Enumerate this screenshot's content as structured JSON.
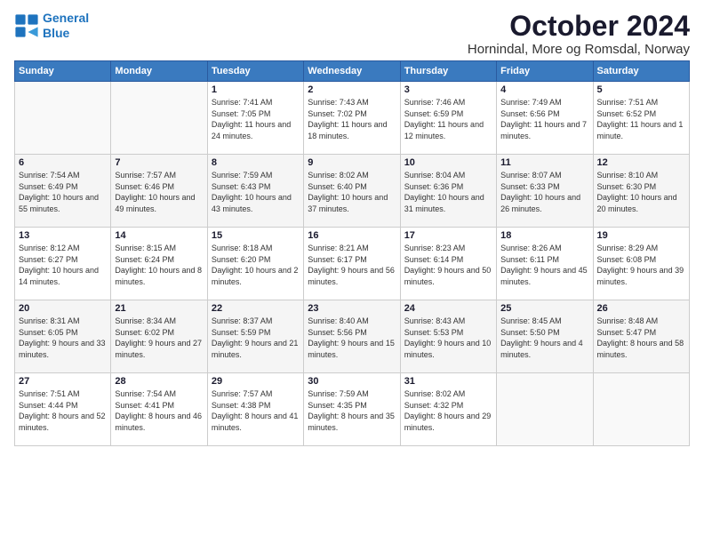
{
  "logo": {
    "line1": "General",
    "line2": "Blue"
  },
  "title": "October 2024",
  "location": "Hornindal, More og Romsdal, Norway",
  "days_of_week": [
    "Sunday",
    "Monday",
    "Tuesday",
    "Wednesday",
    "Thursday",
    "Friday",
    "Saturday"
  ],
  "weeks": [
    [
      {
        "day": "",
        "info": ""
      },
      {
        "day": "",
        "info": ""
      },
      {
        "day": "1",
        "info": "Sunrise: 7:41 AM\nSunset: 7:05 PM\nDaylight: 11 hours\nand 24 minutes."
      },
      {
        "day": "2",
        "info": "Sunrise: 7:43 AM\nSunset: 7:02 PM\nDaylight: 11 hours\nand 18 minutes."
      },
      {
        "day": "3",
        "info": "Sunrise: 7:46 AM\nSunset: 6:59 PM\nDaylight: 11 hours\nand 12 minutes."
      },
      {
        "day": "4",
        "info": "Sunrise: 7:49 AM\nSunset: 6:56 PM\nDaylight: 11 hours\nand 7 minutes."
      },
      {
        "day": "5",
        "info": "Sunrise: 7:51 AM\nSunset: 6:52 PM\nDaylight: 11 hours\nand 1 minute."
      }
    ],
    [
      {
        "day": "6",
        "info": "Sunrise: 7:54 AM\nSunset: 6:49 PM\nDaylight: 10 hours\nand 55 minutes."
      },
      {
        "day": "7",
        "info": "Sunrise: 7:57 AM\nSunset: 6:46 PM\nDaylight: 10 hours\nand 49 minutes."
      },
      {
        "day": "8",
        "info": "Sunrise: 7:59 AM\nSunset: 6:43 PM\nDaylight: 10 hours\nand 43 minutes."
      },
      {
        "day": "9",
        "info": "Sunrise: 8:02 AM\nSunset: 6:40 PM\nDaylight: 10 hours\nand 37 minutes."
      },
      {
        "day": "10",
        "info": "Sunrise: 8:04 AM\nSunset: 6:36 PM\nDaylight: 10 hours\nand 31 minutes."
      },
      {
        "day": "11",
        "info": "Sunrise: 8:07 AM\nSunset: 6:33 PM\nDaylight: 10 hours\nand 26 minutes."
      },
      {
        "day": "12",
        "info": "Sunrise: 8:10 AM\nSunset: 6:30 PM\nDaylight: 10 hours\nand 20 minutes."
      }
    ],
    [
      {
        "day": "13",
        "info": "Sunrise: 8:12 AM\nSunset: 6:27 PM\nDaylight: 10 hours\nand 14 minutes."
      },
      {
        "day": "14",
        "info": "Sunrise: 8:15 AM\nSunset: 6:24 PM\nDaylight: 10 hours\nand 8 minutes."
      },
      {
        "day": "15",
        "info": "Sunrise: 8:18 AM\nSunset: 6:20 PM\nDaylight: 10 hours\nand 2 minutes."
      },
      {
        "day": "16",
        "info": "Sunrise: 8:21 AM\nSunset: 6:17 PM\nDaylight: 9 hours\nand 56 minutes."
      },
      {
        "day": "17",
        "info": "Sunrise: 8:23 AM\nSunset: 6:14 PM\nDaylight: 9 hours\nand 50 minutes."
      },
      {
        "day": "18",
        "info": "Sunrise: 8:26 AM\nSunset: 6:11 PM\nDaylight: 9 hours\nand 45 minutes."
      },
      {
        "day": "19",
        "info": "Sunrise: 8:29 AM\nSunset: 6:08 PM\nDaylight: 9 hours\nand 39 minutes."
      }
    ],
    [
      {
        "day": "20",
        "info": "Sunrise: 8:31 AM\nSunset: 6:05 PM\nDaylight: 9 hours\nand 33 minutes."
      },
      {
        "day": "21",
        "info": "Sunrise: 8:34 AM\nSunset: 6:02 PM\nDaylight: 9 hours\nand 27 minutes."
      },
      {
        "day": "22",
        "info": "Sunrise: 8:37 AM\nSunset: 5:59 PM\nDaylight: 9 hours\nand 21 minutes."
      },
      {
        "day": "23",
        "info": "Sunrise: 8:40 AM\nSunset: 5:56 PM\nDaylight: 9 hours\nand 15 minutes."
      },
      {
        "day": "24",
        "info": "Sunrise: 8:43 AM\nSunset: 5:53 PM\nDaylight: 9 hours\nand 10 minutes."
      },
      {
        "day": "25",
        "info": "Sunrise: 8:45 AM\nSunset: 5:50 PM\nDaylight: 9 hours\nand 4 minutes."
      },
      {
        "day": "26",
        "info": "Sunrise: 8:48 AM\nSunset: 5:47 PM\nDaylight: 8 hours\nand 58 minutes."
      }
    ],
    [
      {
        "day": "27",
        "info": "Sunrise: 7:51 AM\nSunset: 4:44 PM\nDaylight: 8 hours\nand 52 minutes."
      },
      {
        "day": "28",
        "info": "Sunrise: 7:54 AM\nSunset: 4:41 PM\nDaylight: 8 hours\nand 46 minutes."
      },
      {
        "day": "29",
        "info": "Sunrise: 7:57 AM\nSunset: 4:38 PM\nDaylight: 8 hours\nand 41 minutes."
      },
      {
        "day": "30",
        "info": "Sunrise: 7:59 AM\nSunset: 4:35 PM\nDaylight: 8 hours\nand 35 minutes."
      },
      {
        "day": "31",
        "info": "Sunrise: 8:02 AM\nSunset: 4:32 PM\nDaylight: 8 hours\nand 29 minutes."
      },
      {
        "day": "",
        "info": ""
      },
      {
        "day": "",
        "info": ""
      }
    ]
  ]
}
